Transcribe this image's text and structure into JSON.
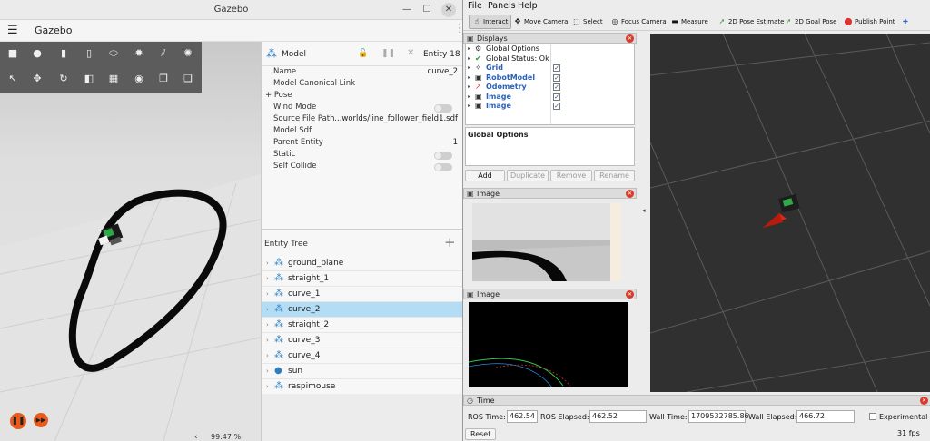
{
  "gazebo": {
    "window_title": "Gazebo",
    "app_title": "Gazebo",
    "rtf": "99.47 %",
    "inspector": {
      "title": "Model",
      "entity": "Entity 18",
      "props": [
        {
          "key": "Name",
          "value": "curve_2"
        },
        {
          "key": "Model Canonical Link",
          "value": ""
        },
        {
          "key": "+ Pose",
          "value": ""
        },
        {
          "key": "Wind Mode",
          "value": ""
        },
        {
          "key": "Source File Path",
          "value": "...worlds/line_follower_field1.sdf"
        },
        {
          "key": "Model Sdf",
          "value": ""
        },
        {
          "key": "Parent Entity",
          "value": "1"
        },
        {
          "key": "Static",
          "value": ""
        },
        {
          "key": "Self Collide",
          "value": ""
        }
      ]
    },
    "entity_tree": {
      "title": "Entity Tree",
      "items": [
        {
          "label": "ground_plane",
          "icon": "model-icon"
        },
        {
          "label": "straight_1",
          "icon": "model-icon"
        },
        {
          "label": "curve_1",
          "icon": "model-icon"
        },
        {
          "label": "curve_2",
          "icon": "model-icon",
          "selected": true
        },
        {
          "label": "straight_2",
          "icon": "model-icon"
        },
        {
          "label": "curve_3",
          "icon": "model-icon"
        },
        {
          "label": "curve_4",
          "icon": "model-icon"
        },
        {
          "label": "sun",
          "icon": "light-icon"
        },
        {
          "label": "raspimouse",
          "icon": "model-icon"
        }
      ]
    },
    "colors": {
      "accent": "#e85b1a",
      "selection": "#b3dcf5",
      "toolbar": "#5c5c5c"
    }
  },
  "rviz": {
    "menu": [
      "File",
      "Panels",
      "Help"
    ],
    "toolbar": {
      "interact": "Interact",
      "move_camera": "Move Camera",
      "select": "Select",
      "focus_camera": "Focus Camera",
      "measure": "Measure",
      "pose_estimate": "2D Pose Estimate",
      "goal_pose": "2D Goal Pose",
      "publish_point": "Publish Point"
    },
    "displays": {
      "title": "Displays",
      "items": [
        {
          "label": "Global Options",
          "icon": "gear-icon",
          "checkbox": false
        },
        {
          "label": "Global Status: Ok",
          "icon": "check-icon",
          "checkbox": false
        },
        {
          "label": "Grid",
          "icon": "grid-icon",
          "checkbox": true
        },
        {
          "label": "RobotModel",
          "icon": "robot-icon",
          "checkbox": true
        },
        {
          "label": "Odometry",
          "icon": "odometry-icon",
          "checkbox": true
        },
        {
          "label": "Image",
          "icon": "image-icon",
          "checkbox": true
        },
        {
          "label": "Image",
          "icon": "image-icon",
          "checkbox": true
        }
      ],
      "description_title": "Global Options",
      "buttons": {
        "add": "Add",
        "duplicate": "Duplicate",
        "remove": "Remove",
        "rename": "Rename"
      }
    },
    "image_panel_1": "Image",
    "image_panel_2": "Image",
    "time": {
      "title": "Time",
      "ros_time_label": "ROS Time:",
      "ros_time": "462.54",
      "ros_elapsed_label": "ROS Elapsed:",
      "ros_elapsed": "462.52",
      "wall_time_label": "Wall Time:",
      "wall_time": "1709532785.86",
      "wall_elapsed_label": "Wall Elapsed:",
      "wall_elapsed": "466.72",
      "experimental": "Experimental",
      "reset": "Reset",
      "fps": "31 fps"
    }
  }
}
